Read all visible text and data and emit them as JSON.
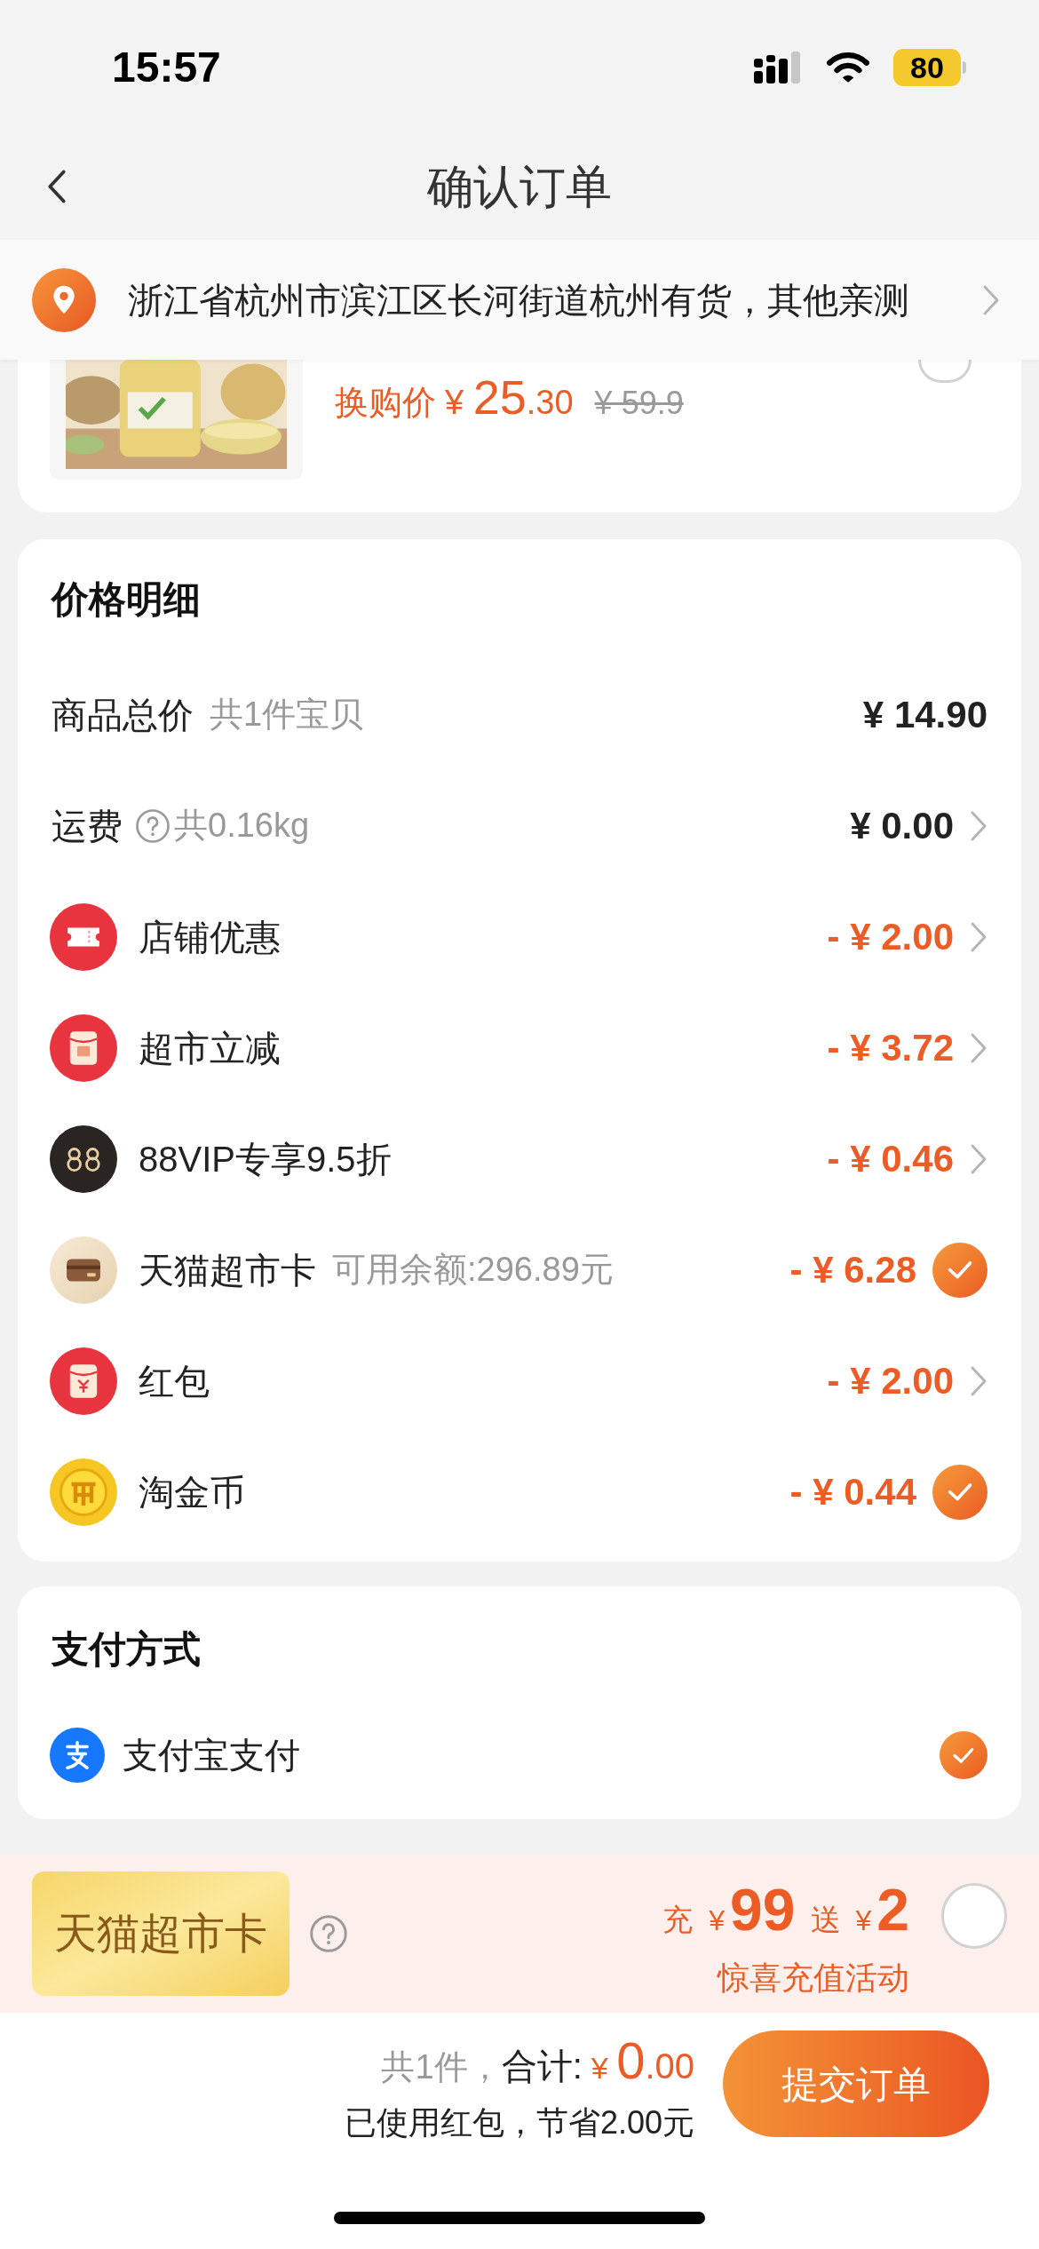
{
  "status_bar": {
    "time": "15:57",
    "battery": "80"
  },
  "nav": {
    "title": "确认订单"
  },
  "address": {
    "text": "浙江省杭州市滨江区长河街道杭州有货，其他亲测"
  },
  "product": {
    "price_label": "换购价",
    "currency": "¥",
    "price_int": "25",
    "price_dec": ".30",
    "original_price": "¥ 59.9",
    "selected": false
  },
  "price_detail": {
    "title": "价格明细",
    "rows": [
      {
        "label": "商品总价",
        "note": "共1件宝贝",
        "amount": "¥ 14.90",
        "kind": "plain",
        "discount": false
      },
      {
        "label": "运费",
        "note": "共0.16kg",
        "amount": "¥ 0.00",
        "kind": "chevron",
        "discount": false,
        "help": true
      },
      {
        "label": "店铺优惠",
        "amount": "- ¥ 2.00",
        "kind": "chevron",
        "discount": true
      },
      {
        "label": "超市立减",
        "amount": "- ¥ 3.72",
        "kind": "chevron",
        "discount": true
      },
      {
        "label": "88VIP专享9.5折",
        "amount": "- ¥ 0.46",
        "kind": "chevron",
        "discount": true
      },
      {
        "label": "天猫超市卡",
        "note": "可用余额:296.89元",
        "amount": "- ¥ 6.28",
        "kind": "check",
        "checked": true,
        "discount": true
      },
      {
        "label": "红包",
        "amount": "- ¥ 2.00",
        "kind": "chevron",
        "discount": true
      },
      {
        "label": "淘金币",
        "amount": "- ¥ 0.44",
        "kind": "check",
        "checked": true,
        "discount": true
      }
    ]
  },
  "payment": {
    "title": "支付方式",
    "methods": [
      {
        "label": "支付宝支付",
        "selected": true
      }
    ]
  },
  "promo": {
    "card_text": "天猫超市卡",
    "charge_label": "充",
    "charge_currency": "¥",
    "charge_amount": "99",
    "bonus_label": "送",
    "bonus_currency": "¥",
    "bonus_amount": "2",
    "subtitle": "惊喜充值活动",
    "selected": false
  },
  "footer": {
    "count": "共1件，",
    "total_label": "合计:",
    "currency": "¥",
    "total_int": "0",
    "total_dec": ".00",
    "saving": "已使用红包，节省2.00元",
    "submit": "提交订单"
  }
}
